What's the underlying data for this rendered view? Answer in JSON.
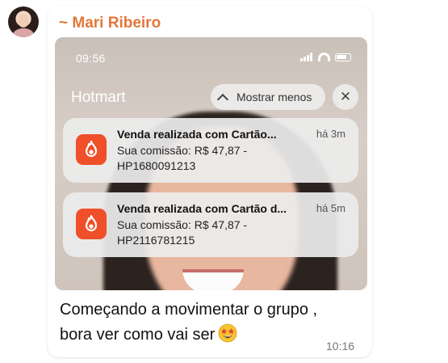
{
  "message": {
    "sender": "~ Mari Ribeiro",
    "caption_line1": "Começando a movimentar o grupo ,",
    "caption_line2": "bora ver como vai ser",
    "time": "10:16",
    "emoji": "star-struck-emoji"
  },
  "phone_screenshot": {
    "status_time": "09:56",
    "app_name": "Hotmart",
    "show_less_label": "Mostrar menos",
    "notifications": [
      {
        "title": "Venda realizada com Cartão...",
        "time": "há 3m",
        "line1": "Sua comissão: R$ 47,87 -",
        "line2": "HP1680091213",
        "icon": "hotmart-flame-icon"
      },
      {
        "title": "Venda realizada com Cartão d...",
        "time": "há 5m",
        "line1": "Sua comissão: R$ 47,87 -",
        "line2": "HP2116781215",
        "icon": "hotmart-flame-icon"
      }
    ]
  },
  "colors": {
    "sender": "#e2763b",
    "hotmart_brand": "#ef4f29"
  }
}
